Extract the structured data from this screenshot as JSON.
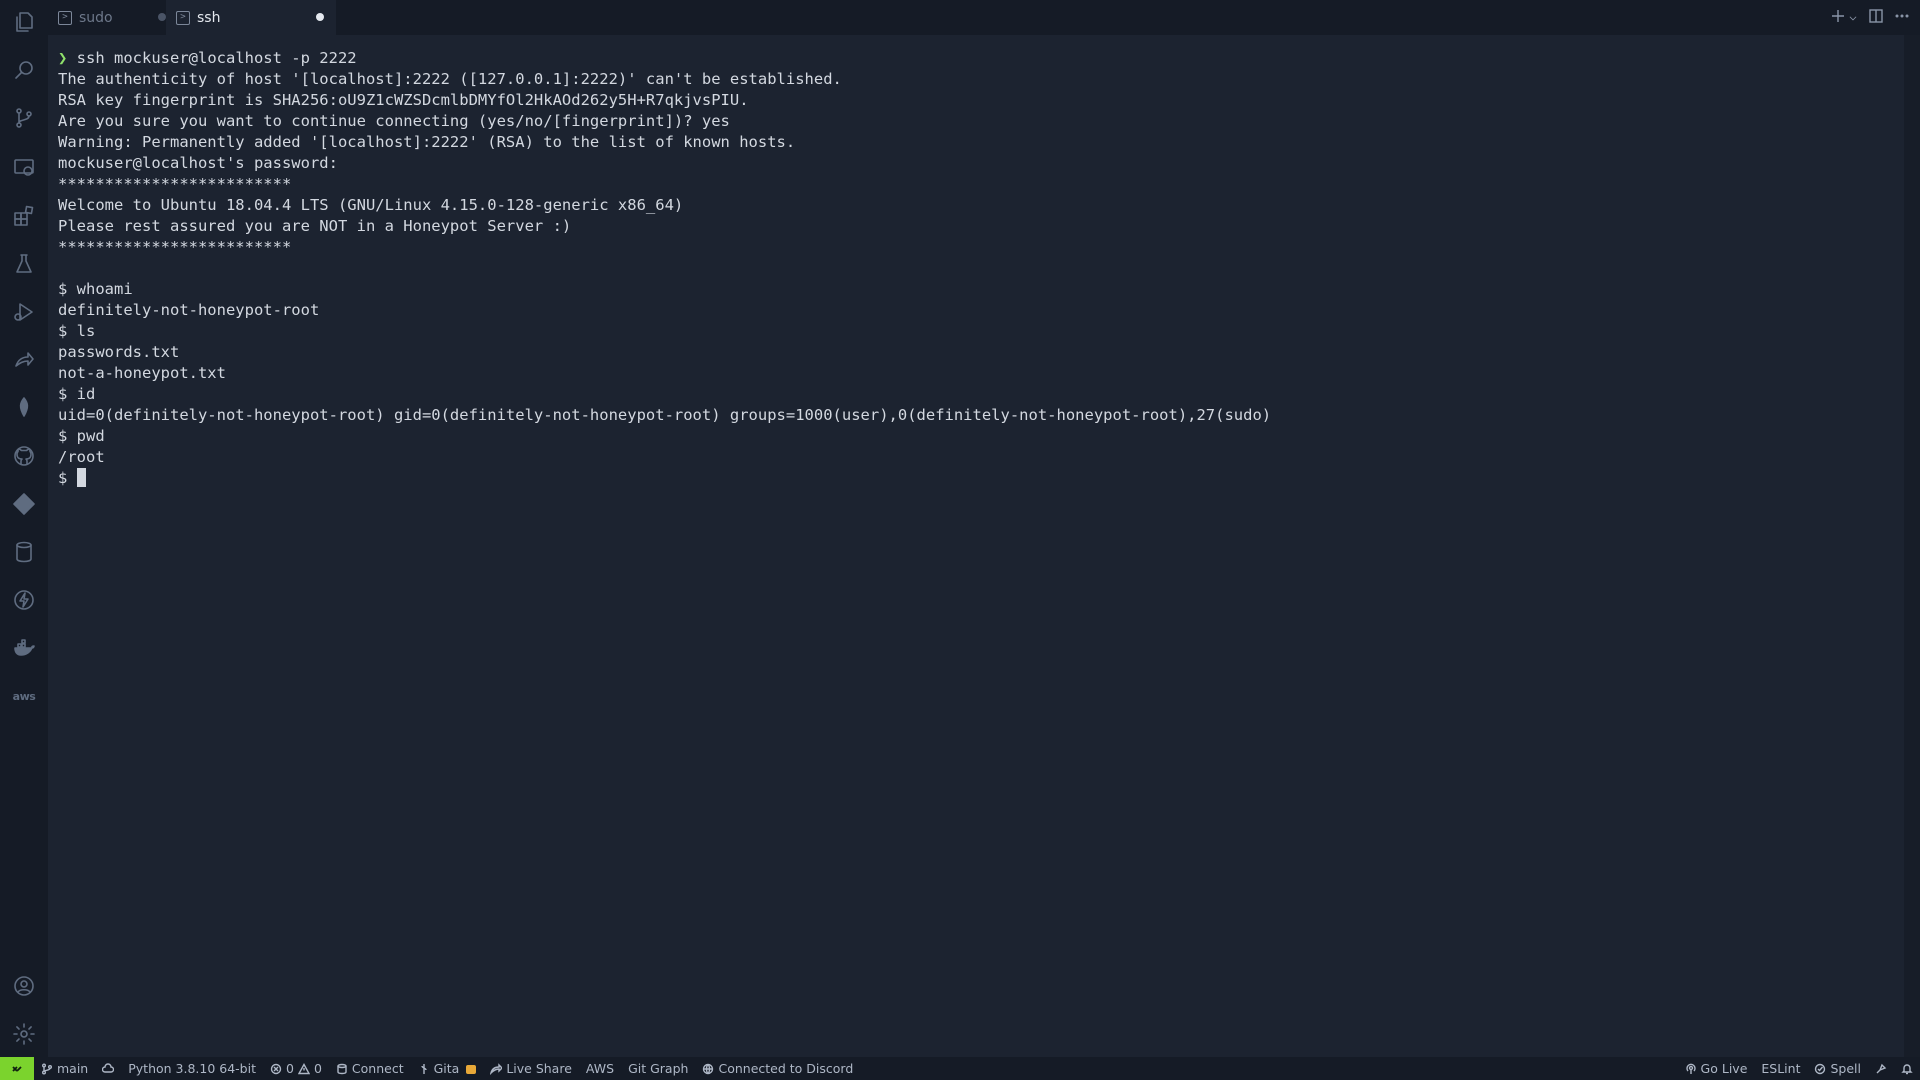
{
  "tabs": [
    {
      "label": "sudo",
      "active": false,
      "icon": "terminal-icon"
    },
    {
      "label": "ssh",
      "active": true,
      "icon": "terminal-icon"
    }
  ],
  "activity_icons": [
    "files-icon",
    "search-icon",
    "source-control-icon",
    "remote-explorer-icon",
    "extensions-icon",
    "testing-icon",
    "run-debug-icon",
    "live-share-icon",
    "mongodb-icon",
    "github-icon",
    "git-icon",
    "database-icon",
    "thunder-client-icon",
    "docker-icon",
    "aws-icon",
    "account-icon",
    "settings-icon"
  ],
  "aws_icon_text": "aws",
  "terminal": {
    "command_prefix": "❯",
    "command": " ssh mockuser@localhost -p 2222",
    "lines": [
      "The authenticity of host '[localhost]:2222 ([127.0.0.1]:2222)' can't be established.",
      "RSA key fingerprint is SHA256:oU9Z1cWZSDcmlbDMYfOl2HkAOd262y5H+R7qkjvsPIU.",
      "Are you sure you want to continue connecting (yes/no/[fingerprint])? yes",
      "Warning: Permanently added '[localhost]:2222' (RSA) to the list of known hosts.",
      "mockuser@localhost's password:",
      "*************************",
      "Welcome to Ubuntu 18.04.4 LTS (GNU/Linux 4.15.0-128-generic x86_64)",
      "Please rest assured you are NOT in a Honeypot Server :)",
      "*************************",
      "",
      "$ whoami",
      "definitely-not-honeypot-root",
      "$ ls",
      "passwords.txt",
      "not-a-honeypot.txt",
      "$ id",
      "uid=0(definitely-not-honeypot-root) gid=0(definitely-not-honeypot-root) groups=1000(user),0(definitely-not-honeypot-root),27(sudo)",
      "$ pwd",
      "/root"
    ],
    "current_prompt": "$ "
  },
  "statusbar": {
    "branch": "main",
    "python": "Python 3.8.10 64-bit",
    "errors": "0",
    "warnings": "0",
    "connect": "Connect",
    "gita": "Gita",
    "live_share": "Live Share",
    "aws": "AWS",
    "git_graph": "Git Graph",
    "discord": "Connected to Discord",
    "go_live": "Go Live",
    "eslint": "ESLint",
    "spell": "Spell"
  },
  "colors": {
    "background": "#151b26",
    "editor": "#1c2330",
    "remote": "#7bd32d",
    "prompt_arrow": "#8fe06b"
  }
}
